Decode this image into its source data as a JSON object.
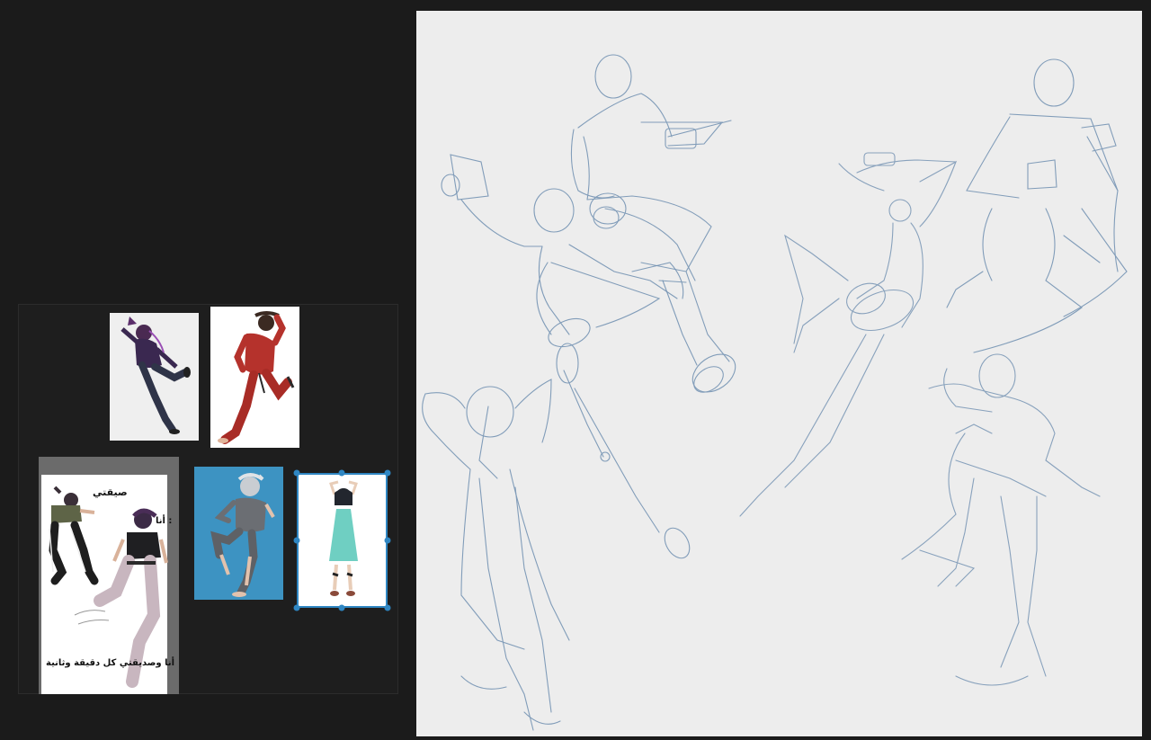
{
  "reference_board": {
    "images": [
      {
        "name": "purple-jacket-pose",
        "background": "#efefef"
      },
      {
        "name": "red-outfit-pose",
        "background": "#ffffff"
      },
      {
        "name": "comic-page",
        "background": "#ffffff",
        "texts": {
          "top": "صيقتي",
          "side": ": أنا",
          "bottom": "أنا وصديقتي كل دقيقة وثانية"
        }
      },
      {
        "name": "grey-hair-pose",
        "background": "#3d93c2"
      },
      {
        "name": "teal-dress-pose",
        "background": "#ffffff",
        "selected": true
      }
    ],
    "selection_color": "#2f86c2"
  },
  "canvas": {
    "background": "#ededed",
    "stroke_color": "#6f8fb0"
  }
}
